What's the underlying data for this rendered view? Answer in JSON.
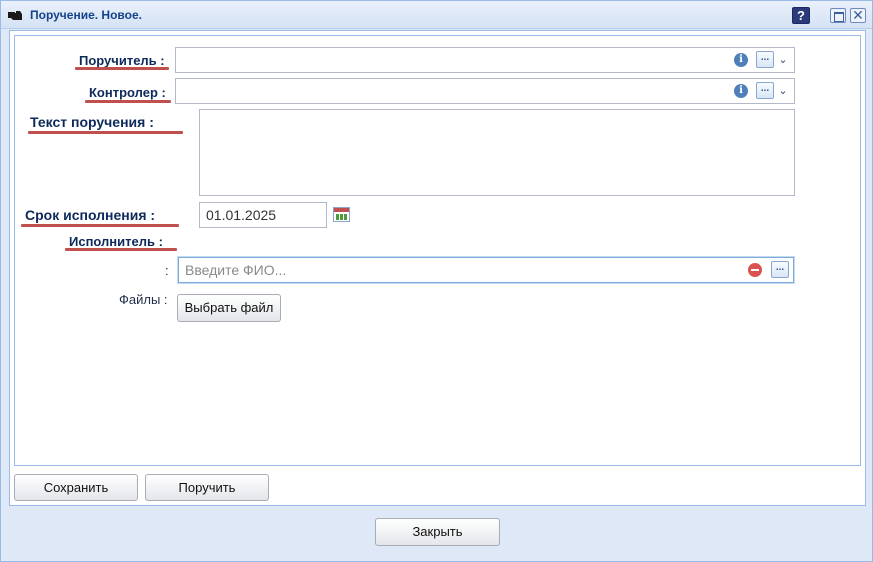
{
  "window": {
    "title": "Поручение. Новое.",
    "help_label": "?",
    "close_label": "✕"
  },
  "form": {
    "poruchitel": {
      "label": "Поручитель :",
      "value": ""
    },
    "kontroler": {
      "label": "Контролер :",
      "value": ""
    },
    "tekst": {
      "label": "Текст поручения :",
      "value": ""
    },
    "srok": {
      "label": "Срок исполнения :",
      "value": "01.01.2025"
    },
    "ispolnitel": {
      "label": "Исполнитель :",
      "prefix": ":",
      "value": "",
      "placeholder": "Введите ФИО..."
    },
    "faily": {
      "label": "Файлы :",
      "button": "Выбрать файл"
    }
  },
  "icons": {
    "info": "i",
    "dots": "...",
    "chevron": "⌄"
  },
  "footer": {
    "save": "Сохранить",
    "assign": "Поручить",
    "close": "Закрыть"
  },
  "colors": {
    "accent_underline": "#c0504d",
    "title": "#15428b",
    "border": "#99bbe8"
  }
}
